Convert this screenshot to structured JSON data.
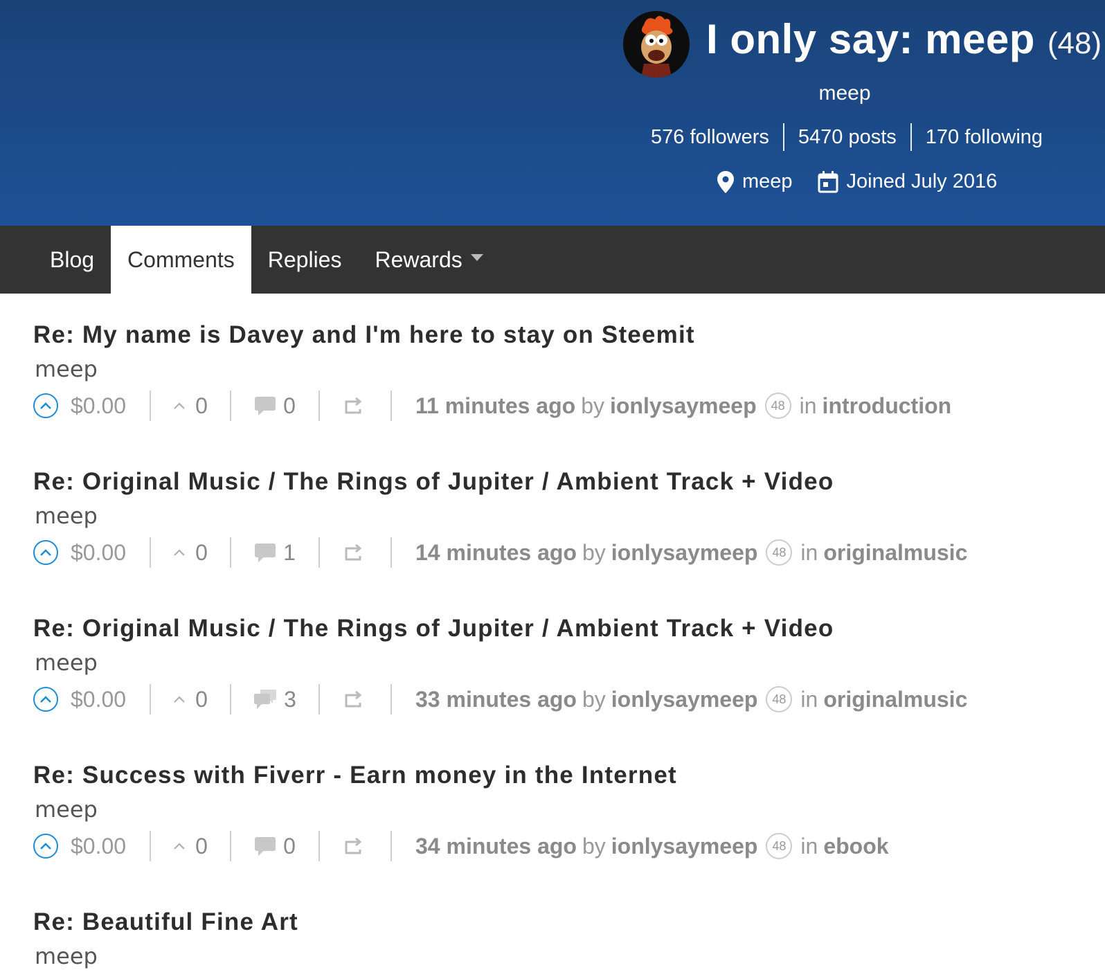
{
  "profile": {
    "name": "I only say: meep",
    "reputation": "(48)",
    "about": "meep",
    "followers": "576 followers",
    "posts": "5470 posts",
    "following": "170 following",
    "location": "meep",
    "joined": "Joined July 2016"
  },
  "tabs": [
    {
      "label": "Blog",
      "active": false
    },
    {
      "label": "Comments",
      "active": true
    },
    {
      "label": "Replies",
      "active": false
    },
    {
      "label": "Rewards",
      "active": false
    }
  ],
  "posts": [
    {
      "title": "Re: My name is Davey and I'm here to stay on Steemit",
      "body": "meep",
      "payout": "$0.00",
      "votes": "0",
      "comments": "0",
      "time": "11 minutes ago",
      "by": "by",
      "author": "ionlysaymeep",
      "author_rep": "48",
      "in": "in",
      "category": "introduction"
    },
    {
      "title": "Re: Original Music / The Rings of Jupiter / Ambient Track + Video",
      "body": "meep",
      "payout": "$0.00",
      "votes": "0",
      "comments": "1",
      "time": "14 minutes ago",
      "by": "by",
      "author": "ionlysaymeep",
      "author_rep": "48",
      "in": "in",
      "category": "originalmusic"
    },
    {
      "title": "Re: Original Music / The Rings of Jupiter / Ambient Track + Video",
      "body": "meep",
      "payout": "$0.00",
      "votes": "0",
      "comments": "3",
      "time": "33 minutes ago",
      "by": "by",
      "author": "ionlysaymeep",
      "author_rep": "48",
      "in": "in",
      "category": "originalmusic"
    },
    {
      "title": "Re: Success with Fiverr - Earn money in the Internet",
      "body": "meep",
      "payout": "$0.00",
      "votes": "0",
      "comments": "0",
      "time": "34 minutes ago",
      "by": "by",
      "author": "ionlysaymeep",
      "author_rep": "48",
      "in": "in",
      "category": "ebook"
    },
    {
      "title": "Re: Beautiful Fine Art",
      "body": "meep"
    }
  ],
  "colors": {
    "header_top": "#1a4278",
    "header_bottom": "#1e5196",
    "tabbar": "#333333",
    "upvote": "#1a8cd8"
  }
}
